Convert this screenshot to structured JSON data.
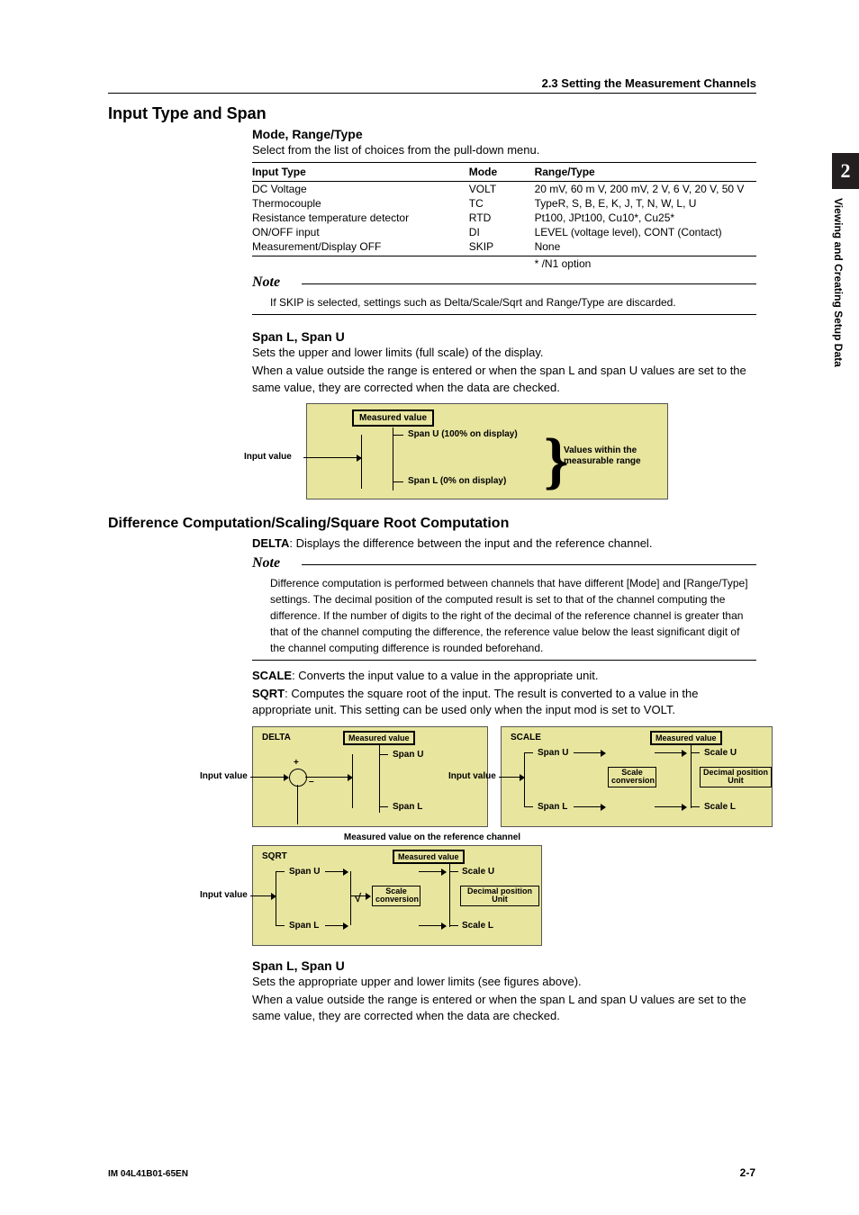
{
  "header": {
    "section_ref": "2.3  Setting the Measurement Channels"
  },
  "tab": {
    "number": "2",
    "text": "Viewing and Creating Setup Data"
  },
  "s1": {
    "title": "Input Type and Span",
    "sub1": "Mode, Range/Type",
    "intro": "Select from the list of choices from the pull-down menu.",
    "table": {
      "h1": "Input Type",
      "h2": "Mode",
      "h3": "Range/Type",
      "rows": [
        {
          "c1": "DC Voltage",
          "c2": "VOLT",
          "c3": "20 mV, 60 m V, 200 mV, 2 V, 6 V, 20 V, 50 V"
        },
        {
          "c1": "Thermocouple",
          "c2": "TC",
          "c3": "TypeR, S, B, E, K, J, T, N, W, L, U"
        },
        {
          "c1": "Resistance temperature detector",
          "c2": "RTD",
          "c3": "Pt100, JPt100, Cu10*, Cu25*"
        },
        {
          "c1": "ON/OFF input",
          "c2": "DI",
          "c3": "LEVEL (voltage level), CONT (Contact)"
        },
        {
          "c1": "Measurement/Display OFF",
          "c2": "SKIP",
          "c3": "None"
        }
      ],
      "footnote": "*  /N1 option"
    },
    "note_label": "Note",
    "note1": "If SKIP is selected, settings such as Delta/Scale/Sqrt and Range/Type are discarded.",
    "sub2": "Span L, Span U",
    "p2a": "Sets the upper and lower limits (full scale) of the display.",
    "p2b": "When a value outside the range is entered or when the span L and span U values are set to the same value, they are corrected when the data are checked.",
    "diag1": {
      "measured": "Measured value",
      "spanu": "Span U (100% on display)",
      "spanl": "Span L (0% on display)",
      "input": "Input value",
      "range": "Values within the measurable range"
    }
  },
  "s2": {
    "title": "Difference Computation/Scaling/Square Root Computation",
    "delta_line": ": Displays the difference between the input and the reference channel.",
    "delta_bold": "DELTA",
    "note_label": "Note",
    "note2": "Difference computation is performed between channels that have different [Mode] and [Range/Type] settings. The decimal position of the computed result is set to that of the channel computing the difference. If the number of digits to the right of the decimal of the reference channel is greater than that of the channel computing the difference, the reference value below the least significant digit of the channel computing difference is rounded beforehand.",
    "scale_bold": "SCALE",
    "scale_line": ": Converts the input value to a value in the appropriate unit.",
    "sqrt_bold": "SQRT",
    "sqrt_line": ": Computes the square root of the input. The result is converted to a value in the appropriate unit. This setting can be used only when the input mod is set to VOLT.",
    "labels": {
      "delta": "DELTA",
      "scale": "SCALE",
      "sqrt": "SQRT",
      "measured": "Measured value",
      "spanu": "Span U",
      "spanl": "Span L",
      "input": "Input value",
      "scaleu": "Scale U",
      "scalel": "Scale L",
      "scaleconv": "Scale conversion",
      "dec_unit": "Decimal position Unit",
      "ref_caption": "Measured value on the reference channel",
      "plus": "+",
      "minus": "–",
      "root": "√"
    },
    "sub3": "Span L, Span U",
    "p3a": "Sets the appropriate upper and lower limits (see figures above).",
    "p3b": "When a value outside the range is entered or when the span L and span U values are set to the same value, they are corrected when the data are checked."
  },
  "footer": {
    "left": "IM 04L41B01-65EN",
    "right": "2-7"
  }
}
